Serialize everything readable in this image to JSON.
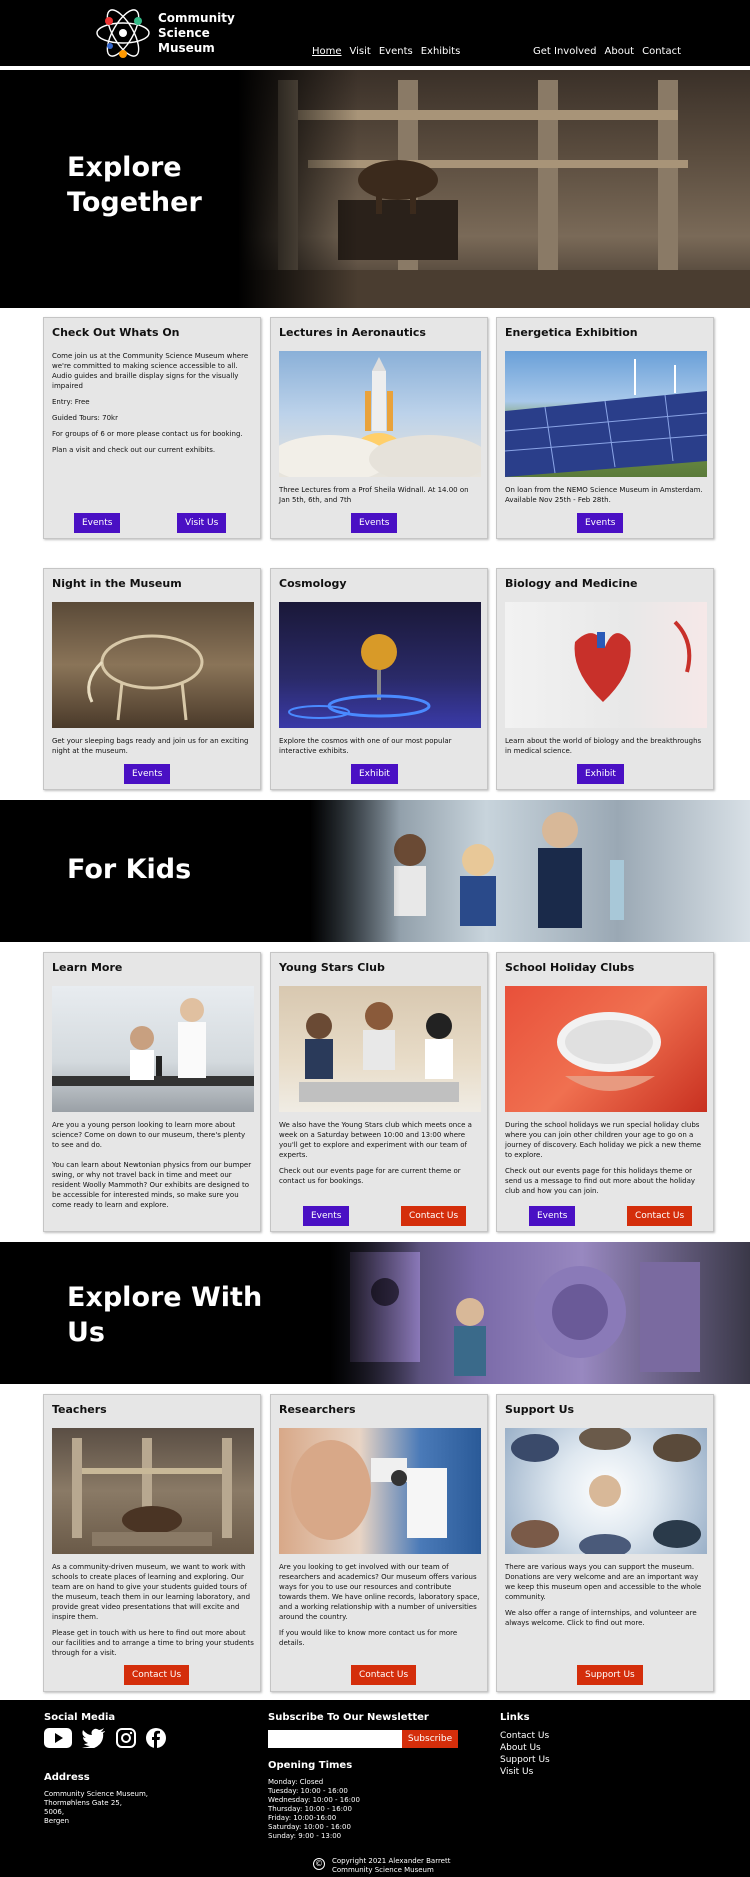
{
  "header": {
    "logo_line1": "Community",
    "logo_line2": "Science",
    "logo_line3": "Museum",
    "nav_left": [
      "Home",
      "Visit",
      "Events",
      "Exhibits"
    ],
    "nav_right": [
      "Get Involved",
      "About",
      "Contact"
    ]
  },
  "hero": {
    "title_line1": "Explore",
    "title_line2": "Together"
  },
  "whats_on": {
    "title": "Check Out Whats On",
    "p1": "Come join us at the Community Science Museum where we're committed to making science accessible to all. Audio guides and braille display signs for the visually impaired",
    "p2": "Entry: Free",
    "p3": "Guided Tours: 70kr",
    "p4": "For groups of 6 or more please contact us for booking.",
    "p5": "Plan a visit and check out our current exhibits.",
    "btn1": "Events",
    "btn2": "Visit Us"
  },
  "aeronautics": {
    "title": "Lectures in Aeronautics",
    "text": "Three Lectures from a Prof Sheila Widnall. At 14.00 on Jan 5th, 6th, and 7th",
    "btn": "Events"
  },
  "energetica": {
    "title": "Energetica Exhibition",
    "text": "On loan from the NEMO Science Museum in Amsterdam. Available Nov 25th - Feb 28th.",
    "btn": "Events"
  },
  "night": {
    "title": "Night in the Museum",
    "text": "Get your sleeping bags ready and join us for an exciting night at the museum.",
    "btn": "Events"
  },
  "cosmology": {
    "title": "Cosmology",
    "text": "Explore the cosmos with one of our most popular interactive exhibits.",
    "btn": "Exhibit"
  },
  "biology": {
    "title": "Biology and Medicine",
    "text": "Learn about the world of biology and the breakthroughs in medical science.",
    "btn": "Exhibit"
  },
  "kids_banner": {
    "title": "For Kids"
  },
  "learn_more": {
    "title": "Learn More",
    "p1": "Are you a young person looking to learn more about science? Come on down to our museum, there's plenty to see and do.",
    "p2": "You can learn about Newtonian physics from our bumper swing, or why not travel back in time and meet our resident Woolly Mammoth? Our exhibits are designed to be accessible for interested minds, so make sure you come ready to learn and explore."
  },
  "young_stars": {
    "title": "Young Stars Club",
    "p1": "We also have the Young Stars club which meets once a week on a Saturday between 10:00 and 13:00 where you'll get to explore and experiment with our team of experts.",
    "p2": "Check out our events page for are current theme or contact us for bookings.",
    "btn1": "Events",
    "btn2": "Contact Us"
  },
  "holiday": {
    "title": "School Holiday Clubs",
    "p1": "During the school holidays we run special holiday clubs where you can join other children your age to go on a journey of discovery. Each holiday we pick a new theme to explore.",
    "p2": "Check out our events page for this holidays theme or send us a message to find out more about the holiday club and how you can join.",
    "btn1": "Events",
    "btn2": "Contact Us"
  },
  "explore_banner": {
    "title_line1": "Explore With",
    "title_line2": "Us"
  },
  "teachers": {
    "title": "Teachers",
    "p1": "As a community-driven museum, we want to work with schools to create places of learning and exploring. Our team are on hand to give your students guided tours of the museum, teach them in our learning laboratory, and provide great video presentations that will excite and inspire them.",
    "p2": "Please get in touch with us here to find out more about our facilities and to arrange a time to bring your students through for a visit.",
    "btn": "Contact Us"
  },
  "researchers": {
    "title": "Researchers",
    "p1": "Are you looking to get involved with our team of researchers and academics? Our museum offers various ways for you to use our resources and contribute towards them. We have online records, laboratory space, and a working relationship with a number of universities around the country.",
    "p2": "If you would like to know more contact us for more details.",
    "btn": "Contact Us"
  },
  "support": {
    "title": "Support Us",
    "p1": "There are various ways you can support the museum. Donations are very welcome and are an important way we keep this museum open and accessible to the whole community.",
    "p2": "We also offer a range of internships, and volunteer are always welcome. Click to find out more.",
    "btn": "Support Us"
  },
  "footer": {
    "social_title": "Social Media",
    "social_icons": [
      "youtube-icon",
      "twitter-icon",
      "instagram-icon",
      "facebook-icon"
    ],
    "address_title": "Address",
    "address": [
      "Community Science Museum,",
      "Thormøhlens Gate 25,",
      "5006,",
      "Bergen"
    ],
    "newsletter_title": "Subscribe To Our Newsletter",
    "newsletter_placeholder": "",
    "subscribe_label": "Subscribe",
    "opening_title": "Opening Times",
    "opening": [
      "Monday: Closed",
      "Tuesday: 10:00 - 16:00",
      "Wednesday: 10:00 - 16:00",
      "Thursday: 10:00 - 16:00",
      "Friday: 10:00-16:00",
      "Saturday: 10:00 - 16:00",
      "Sunday: 9:00 - 13:00"
    ],
    "links_title": "Links",
    "links": [
      "Contact Us",
      "About Us",
      "Support Us",
      "Visit Us"
    ],
    "copyright_line1": "Copyright 2021 Alexander Barrett",
    "copyright_line2": "Community Science Museum"
  },
  "colors": {
    "purple_button": "#4a10c4",
    "red_button": "#d42e0b",
    "card_bg": "#e6e6e6"
  }
}
